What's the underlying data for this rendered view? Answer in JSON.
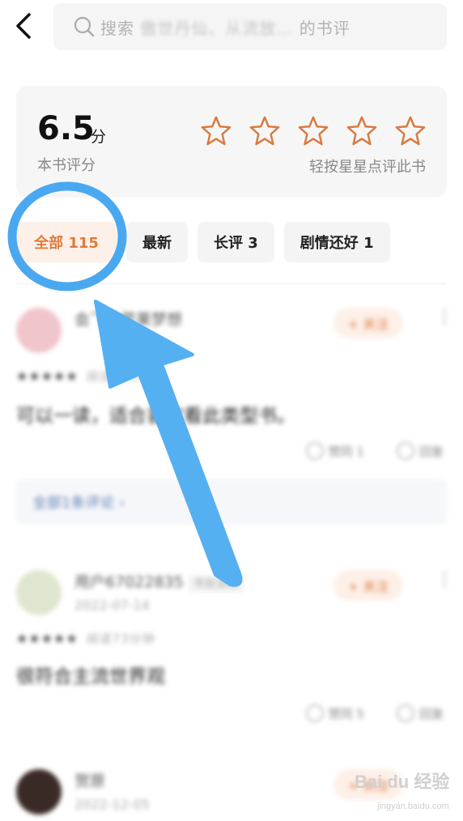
{
  "header": {
    "search_placeholder_prefix": "搜索",
    "search_placeholder_hidden": "傲世丹仙、从流放…",
    "search_placeholder_suffix": "的书评"
  },
  "rating": {
    "score": "6.5",
    "unit": "分",
    "label": "本书评分",
    "hint": "轻按星星点评此书",
    "star_count": 5
  },
  "tabs": [
    {
      "label": "全部 115",
      "active": true
    },
    {
      "label": "最新",
      "active": false
    },
    {
      "label": "长评 3",
      "active": false
    },
    {
      "label": "剧情还好 1",
      "active": false
    }
  ],
  "reviews": [
    {
      "name": "会飞的苹果梦想",
      "date": "",
      "follow": "+ 关注",
      "stars": "★★★★★",
      "read_time": "阅读的时候",
      "text": "可以一读，适合喜欢看此类型书。",
      "likes": "赞同 1",
      "reply": "回复"
    },
    {
      "name": "用户67022835",
      "badge": "书友读过",
      "date": "2022-07-14",
      "follow": "+ 关注",
      "stars": "★★★★★",
      "read_time": "阅读73分钟",
      "text": "很符合主流世界观",
      "likes": "赞同 5",
      "reply": "回复"
    },
    {
      "name": "贺原",
      "date": "2022-12-05",
      "follow": "+ 关注"
    }
  ],
  "all_comments": "全部1条评论 ›",
  "watermark": {
    "brand": "Bai du 经验",
    "url": "jingyan.baidu.com"
  },
  "colors": {
    "accent": "#e07a3c",
    "highlight": "#4aa8f0"
  }
}
